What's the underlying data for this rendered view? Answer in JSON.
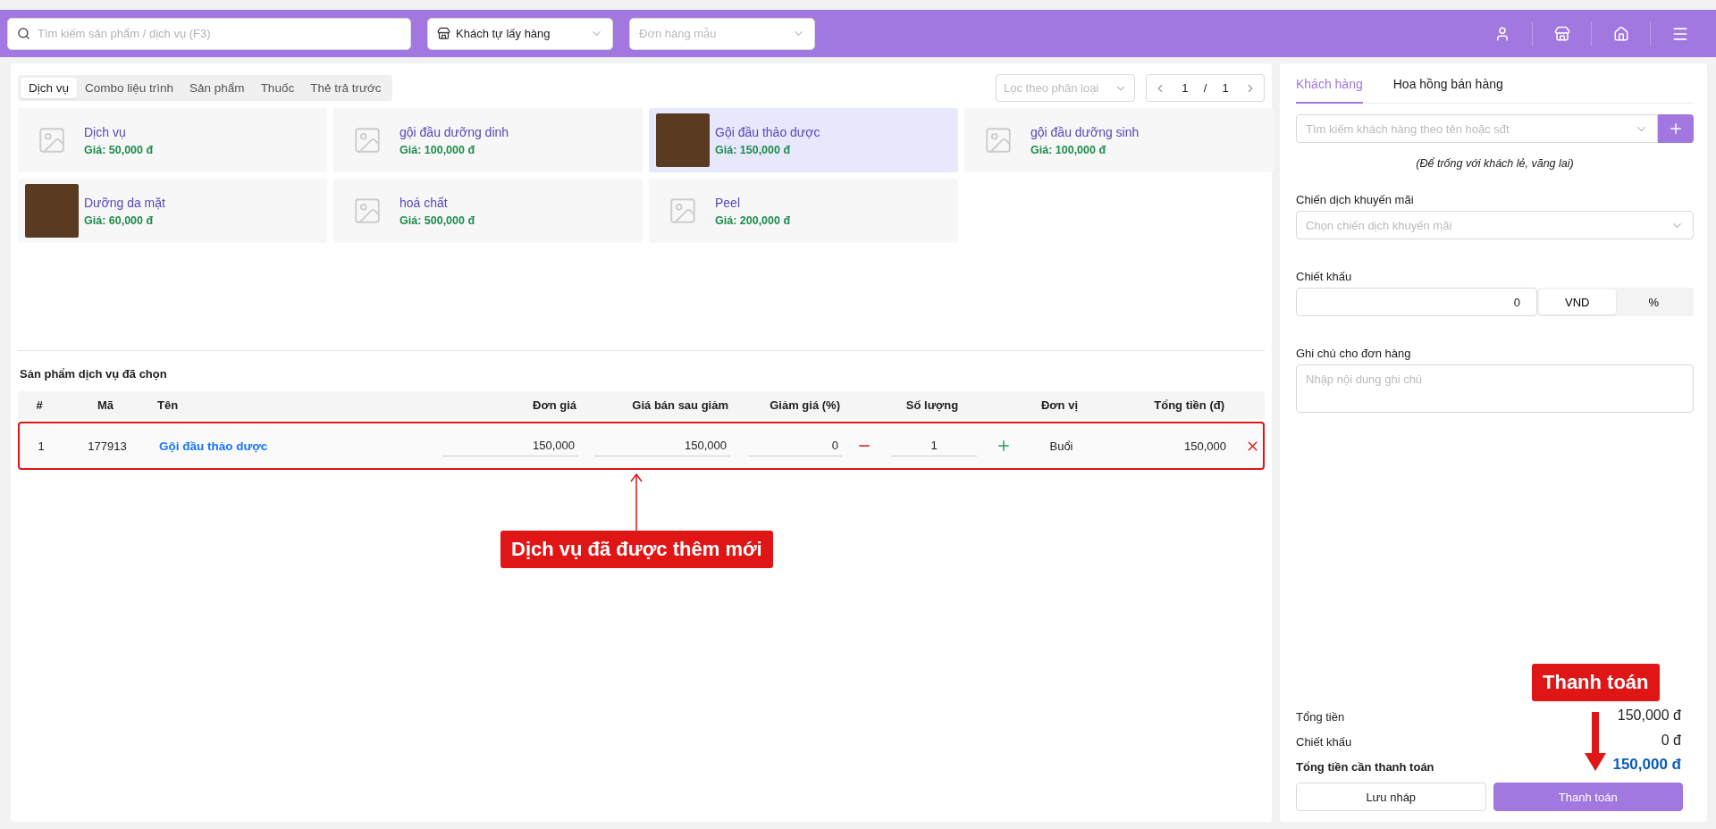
{
  "top_bar": {
    "search": {
      "placeholder": "Tìm kiếm sản phẩm / dịch vụ (F3)"
    },
    "delivery_select": {
      "value": "Khách tự lấy hàng"
    },
    "template_select": {
      "placeholder": "Đơn hàng mẫu"
    }
  },
  "category_tabs": [
    {
      "label": "Dịch vụ",
      "selected": true
    },
    {
      "label": "Combo liệu trình",
      "selected": false
    },
    {
      "label": "Sản phẩm",
      "selected": false
    },
    {
      "label": "Thuốc",
      "selected": false
    },
    {
      "label": "Thẻ trả trước",
      "selected": false
    }
  ],
  "filter": {
    "placeholder": "Lọc theo phân loại"
  },
  "pagination": {
    "current": "1",
    "separator": "/",
    "total": "1"
  },
  "products": [
    {
      "name": "Dịch vụ",
      "price": "Giá: 50,000 đ",
      "kind": "placeholder",
      "selected": false
    },
    {
      "name": "gội đầu dưỡng dinh",
      "price": "Giá: 100,000 đ",
      "kind": "placeholder",
      "selected": false
    },
    {
      "name": "Gội đầu thảo dược",
      "price": "Giá: 150,000 đ",
      "kind": "photo",
      "selected": true
    },
    {
      "name": "gội đầu dưỡng sinh",
      "price": "Giá: 100,000 đ",
      "kind": "placeholder",
      "selected": false
    },
    {
      "name": "Dưỡng da mặt",
      "price": "Giá: 60,000 đ",
      "kind": "photo",
      "selected": false
    },
    {
      "name": "hoá chất",
      "price": "Giá: 500,000 đ",
      "kind": "placeholder",
      "selected": false
    },
    {
      "name": "Peel",
      "price": "Giá: 200,000 đ",
      "kind": "placeholder",
      "selected": false
    }
  ],
  "selected_items": {
    "title": "Sản phẩm dịch vụ đã chọn",
    "columns": [
      "#",
      "Mã",
      "Tên",
      "Đơn giá",
      "Giá bán sau giảm",
      "Giảm giá (%)",
      "Số lượng",
      "Đơn vị",
      "Tổng tiền (đ)"
    ],
    "rows": [
      {
        "index": "1",
        "code": "177913",
        "name": "Gội đầu thảo dược",
        "unit_price": "150,000",
        "sale_price": "150,000",
        "discount": "0",
        "quantity": "1",
        "unit": "Buổi",
        "total": "150,000",
        "highlighted": true
      }
    ]
  },
  "annotations": [
    {
      "kind": "up",
      "text": "Dịch vụ đã được thêm mới"
    },
    {
      "kind": "down",
      "text": "Thanh toán"
    }
  ],
  "side_tabs": [
    {
      "label": "Khách hàng",
      "selected": true
    },
    {
      "label": "Hoa hồng bán hàng",
      "selected": false
    }
  ],
  "customer": {
    "placeholder": "Tìm kiếm khách hàng theo tên hoặc sđt",
    "hint": "(Để trống với khách lẻ, vãng lai)"
  },
  "promotion": {
    "label": "Chiến dịch khuyến mãi",
    "placeholder": "Chọn chiến dịch khuyến mãi"
  },
  "discount": {
    "label": "Chiết khấu",
    "value": "0",
    "units": [
      {
        "label": "VND",
        "selected": true
      },
      {
        "label": "%",
        "selected": false
      }
    ]
  },
  "note": {
    "label": "Ghi chú cho đơn hàng",
    "placeholder": "Nhập nội dung ghi chú"
  },
  "totals": [
    {
      "label": "Tổng tiền",
      "value": "150,000 đ",
      "emphasis": false
    },
    {
      "label": "Chiết khấu",
      "value": "0 đ",
      "emphasis": false
    },
    {
      "label": "Tổng tiền cần thanh toán",
      "value": "150,000 đ",
      "emphasis": true
    }
  ],
  "buttons": [
    {
      "label": "Lưu nháp",
      "kind": "secondary"
    },
    {
      "label": "Thanh toán",
      "kind": "primary"
    }
  ]
}
